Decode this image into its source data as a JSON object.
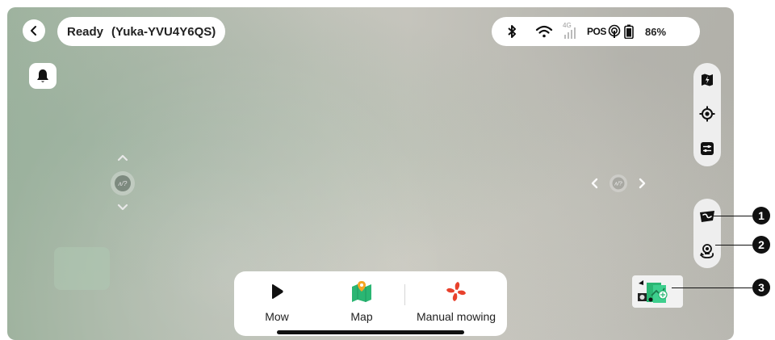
{
  "header": {
    "status": "Ready",
    "device_name": "(Yuka-YVU4Y6QS)"
  },
  "system_status": {
    "network_type": "4G",
    "positioning_label": "POS",
    "battery_percent": "86%"
  },
  "bottom_nav": {
    "items": [
      {
        "label": "Mow",
        "icon": "play-icon"
      },
      {
        "label": "Map",
        "icon": "map-icon"
      },
      {
        "label": "Manual mowing",
        "icon": "fan-icon"
      }
    ]
  },
  "callouts": [
    "1",
    "2",
    "3"
  ],
  "colors": {
    "map_green": "#2bb673",
    "map_pin": "#f5a623",
    "fan_red": "#e8412c",
    "dark_icon": "#1a1a1a"
  }
}
